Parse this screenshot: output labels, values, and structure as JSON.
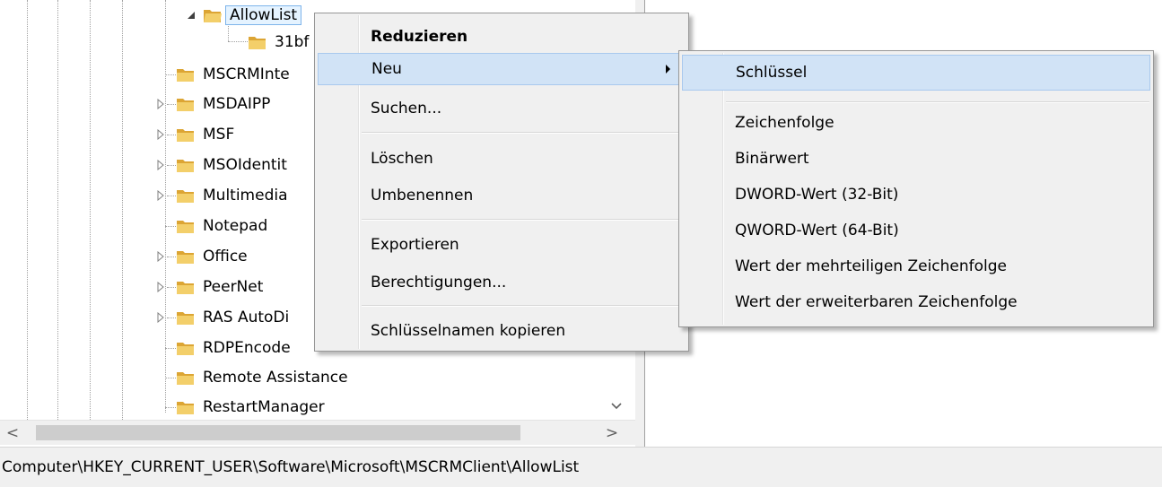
{
  "tree": {
    "items": [
      {
        "label": "AllowList",
        "expander": "expanded"
      },
      {
        "label": "31bf",
        "expander": "none"
      },
      {
        "label": "MSCRMInte",
        "expander": "none"
      },
      {
        "label": "MSDAIPP",
        "expander": "collapsed"
      },
      {
        "label": "MSF",
        "expander": "collapsed"
      },
      {
        "label": "MSOIdentit",
        "expander": "collapsed"
      },
      {
        "label": "Multimedia",
        "expander": "collapsed"
      },
      {
        "label": "Notepad",
        "expander": "none"
      },
      {
        "label": "Office",
        "expander": "collapsed"
      },
      {
        "label": "PeerNet",
        "expander": "collapsed"
      },
      {
        "label": "RAS AutoDi",
        "expander": "collapsed"
      },
      {
        "label": "RDPEncode",
        "expander": "none"
      },
      {
        "label": "Remote Assistance",
        "expander": "none"
      },
      {
        "label": "RestartManager",
        "expander": "none"
      }
    ],
    "selected_index": 0,
    "folder_color": "#e8b94a"
  },
  "scroll": {
    "down_glyph": "⌄",
    "left_glyph": "<",
    "right_glyph": ">"
  },
  "status": {
    "path": "Computer\\HKEY_CURRENT_USER\\Software\\Microsoft\\MSCRMClient\\AllowList"
  },
  "context_menu": {
    "items": [
      {
        "label": "Reduzieren",
        "bold": true
      },
      {
        "label": "Neu",
        "submenu": true,
        "highlighted": true
      },
      {
        "label": "Suchen..."
      },
      {
        "label": "Löschen"
      },
      {
        "label": "Umbenennen"
      },
      {
        "label": "Exportieren"
      },
      {
        "label": "Berechtigungen..."
      },
      {
        "label": "Schlüsselnamen kopieren"
      }
    ],
    "highlight_color": "#d1e3f6"
  },
  "new_submenu": {
    "items": [
      {
        "label": "Schlüssel",
        "highlighted": true
      },
      {
        "label": "Zeichenfolge"
      },
      {
        "label": "Binärwert"
      },
      {
        "label": "DWORD-Wert (32-Bit)"
      },
      {
        "label": "QWORD-Wert (64-Bit)"
      },
      {
        "label": "Wert der mehrteiligen Zeichenfolge"
      },
      {
        "label": "Wert der erweiterbaren Zeichenfolge"
      }
    ]
  }
}
